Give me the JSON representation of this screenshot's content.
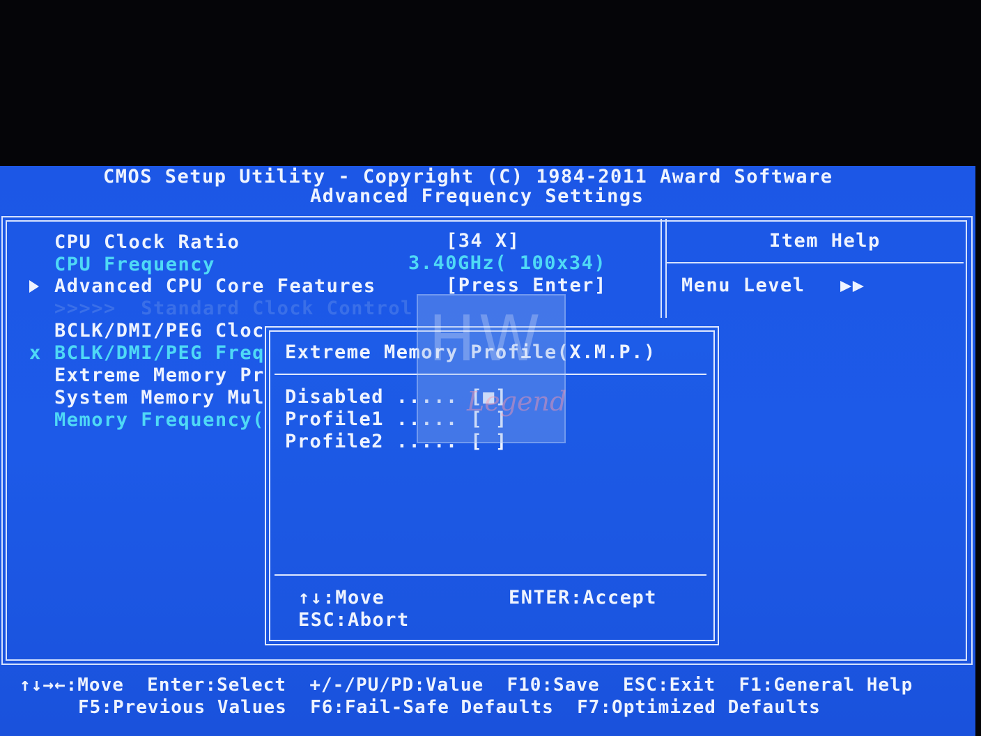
{
  "header": {
    "line1": "CMOS Setup Utility - Copyright (C) 1984-2011 Award Software",
    "line2": "Advanced Frequency Settings"
  },
  "menu": {
    "cpu_clock_ratio": {
      "label": "CPU Clock Ratio",
      "value": "[34 X]"
    },
    "cpu_frequency": {
      "label": "CPU Frequency",
      "value": "3.40GHz( 100x34)"
    },
    "advanced_cpu": {
      "label": "Advanced CPU Core Features",
      "value": "[Press Enter]"
    },
    "standard_clock": {
      "label": ">>>>>  Standard Clock Control"
    },
    "bclk_cloc": {
      "label": "BCLK/DMI/PEG Cloc"
    },
    "bclk_freq": {
      "marker": "x",
      "label": "BCLK/DMI/PEG Freq"
    },
    "extreme_memory": {
      "label": "Extreme Memory Pr"
    },
    "system_memory": {
      "label": "System Memory Mul"
    },
    "memory_frequency": {
      "label": "Memory Frequency("
    }
  },
  "help": {
    "title": "Item Help",
    "menu_level_label": "Menu Level",
    "menu_level_value": "▶▶"
  },
  "popup": {
    "title": "Extreme Memory Profile(X.M.P.)",
    "options": [
      {
        "label": "Disabled ..... [■]"
      },
      {
        "label": "Profile1 ..... [ ]"
      },
      {
        "label": "Profile2 ..... [ ]"
      }
    ],
    "move": "↑↓:Move",
    "accept": "ENTER:Accept",
    "abort": "ESC:Abort"
  },
  "footer": {
    "line1": "↑↓→←:Move  Enter:Select  +/-/PU/PD:Value  F10:Save  ESC:Exit  F1:General Help",
    "line2": "F5:Previous Values  F6:Fail-Safe Defaults  F7:Optimized Defaults"
  },
  "watermark": {
    "top": "HW",
    "bottom": "Legend"
  },
  "colors": {
    "background": "#1c57e6",
    "text_white": "#eef3ff",
    "text_cyan": "#4fd9f6",
    "text_disabled": "#3a6fe8",
    "frame": "#d6e2ff"
  }
}
